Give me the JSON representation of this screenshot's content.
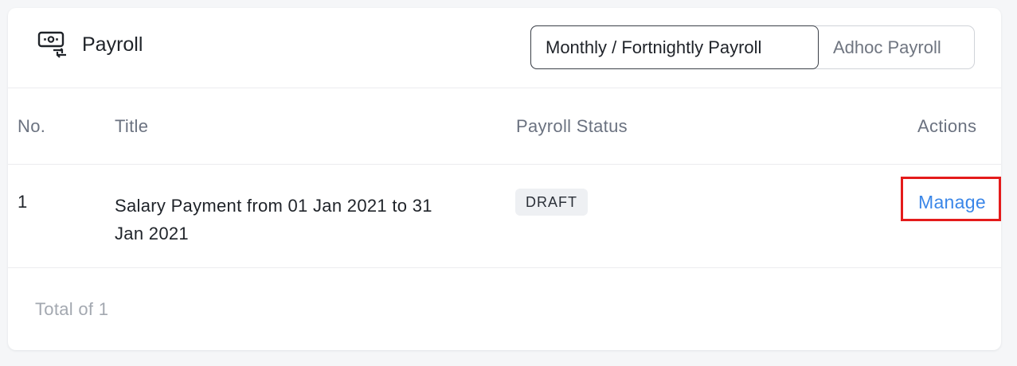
{
  "header": {
    "title": "Payroll",
    "icon": "payroll-cash-icon",
    "tabs": [
      {
        "label": "Monthly / Fortnightly Payroll",
        "active": true
      },
      {
        "label": "Adhoc Payroll",
        "active": false
      }
    ]
  },
  "table": {
    "columns": [
      "No.",
      "Title",
      "Payroll Status",
      "Actions"
    ],
    "rows": [
      {
        "no": "1",
        "title": "Salary Payment from 01 Jan 2021 to 31 Jan 2021",
        "status": "DRAFT",
        "action": "Manage"
      }
    ],
    "footer": "Total of 1"
  },
  "colors": {
    "accent_link": "#3a86e8",
    "highlight_box": "#e41b1b",
    "badge_bg": "#eef0f3"
  }
}
